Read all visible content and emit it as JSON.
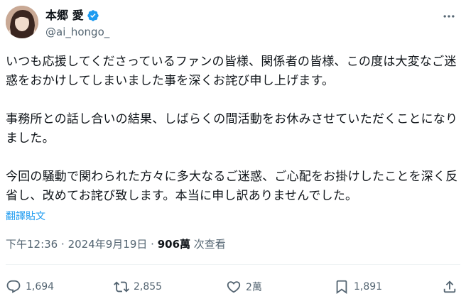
{
  "author": {
    "display_name": "本郷 愛",
    "handle": "@ai_hongo_"
  },
  "tweet": {
    "paragraphs": [
      "いつも応援してくださっているファンの皆様、関係者の皆様、この度は大変なご迷惑をおかけしてしまいました事を深くお詫び申し上げます。",
      "事務所との話し合いの結果、しばらくの間活動をお休みさせていただくことになりました。",
      "今回の騒動で関わられた方々に多大なるご迷惑、ご心配をお掛けしたことを深く反省し、改めてお詫び致します。本当に申し訳ありませんでした。"
    ],
    "translate_label": "翻譯貼文",
    "time": "下午12:36",
    "date": "2024年9月19日",
    "views_count": "906萬",
    "views_label": "次查看"
  },
  "actions": {
    "replies": "1,694",
    "retweets": "2,855",
    "likes": "2萬",
    "bookmarks": "1,891"
  },
  "colors": {
    "accent": "#1d9bf0",
    "text_primary": "#0f1419",
    "text_secondary": "#536471"
  },
  "icons": [
    "verified-badge-icon",
    "more-icon",
    "reply-icon",
    "retweet-icon",
    "like-icon",
    "bookmark-icon",
    "share-icon"
  ]
}
